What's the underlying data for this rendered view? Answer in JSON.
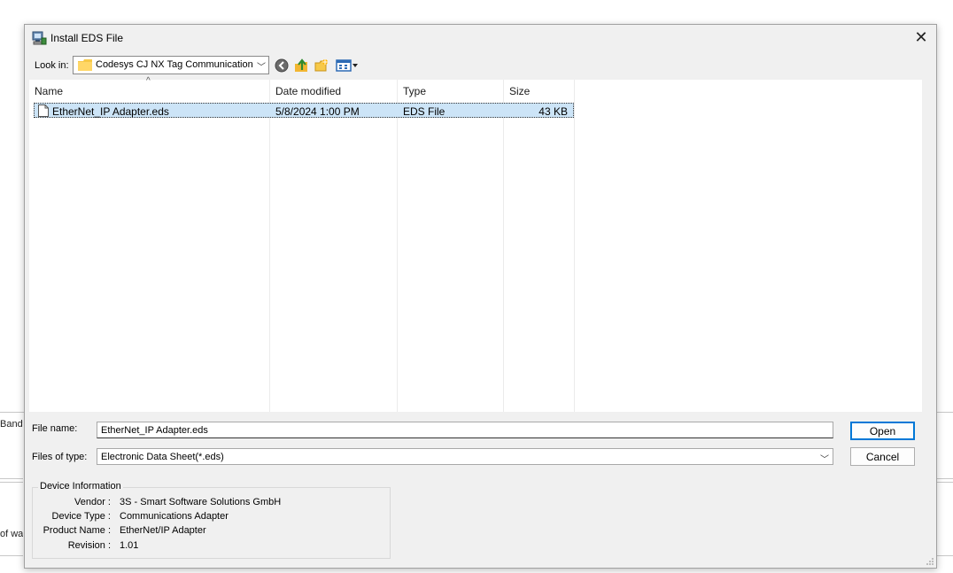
{
  "background": {
    "left_label_1": "Bandw",
    "left_label_2": "of wan"
  },
  "dialog": {
    "title": "Install EDS File",
    "close_glyph": "✕"
  },
  "toolbar": {
    "look_in_label": "Look in:",
    "look_in_value": "Codesys CJ NX Tag Communication T",
    "back_icon": "back-icon",
    "up_icon": "up-folder-icon",
    "new_folder_icon": "new-folder-icon",
    "views_icon": "views-menu-icon"
  },
  "file_list": {
    "columns": [
      "Name",
      "Date modified",
      "Type",
      "Size"
    ],
    "rows": [
      {
        "name": "EtherNet_IP Adapter.eds",
        "date": "5/8/2024 1:00 PM",
        "type": "EDS File",
        "size": "43 KB"
      }
    ]
  },
  "file_name": {
    "label": "File name:",
    "value": "EtherNet_IP Adapter.eds"
  },
  "files_of_type": {
    "label": "Files of type:",
    "value": "Electronic Data Sheet(*.eds)"
  },
  "buttons": {
    "open": "Open",
    "cancel": "Cancel"
  },
  "device_info": {
    "title": "Device Information",
    "vendor_key": "Vendor :",
    "vendor": "3S - Smart Software Solutions GmbH",
    "device_type_key": "Device Type :",
    "device_type": "Communications Adapter",
    "product_name_key": "Product Name :",
    "product_name": "EtherNet/IP Adapter",
    "revision_key": "Revision :",
    "revision": "1.01"
  },
  "colors": {
    "selection": "#cce4f7",
    "accent": "#0078d7",
    "dialog_bg": "#f0f0f0"
  }
}
